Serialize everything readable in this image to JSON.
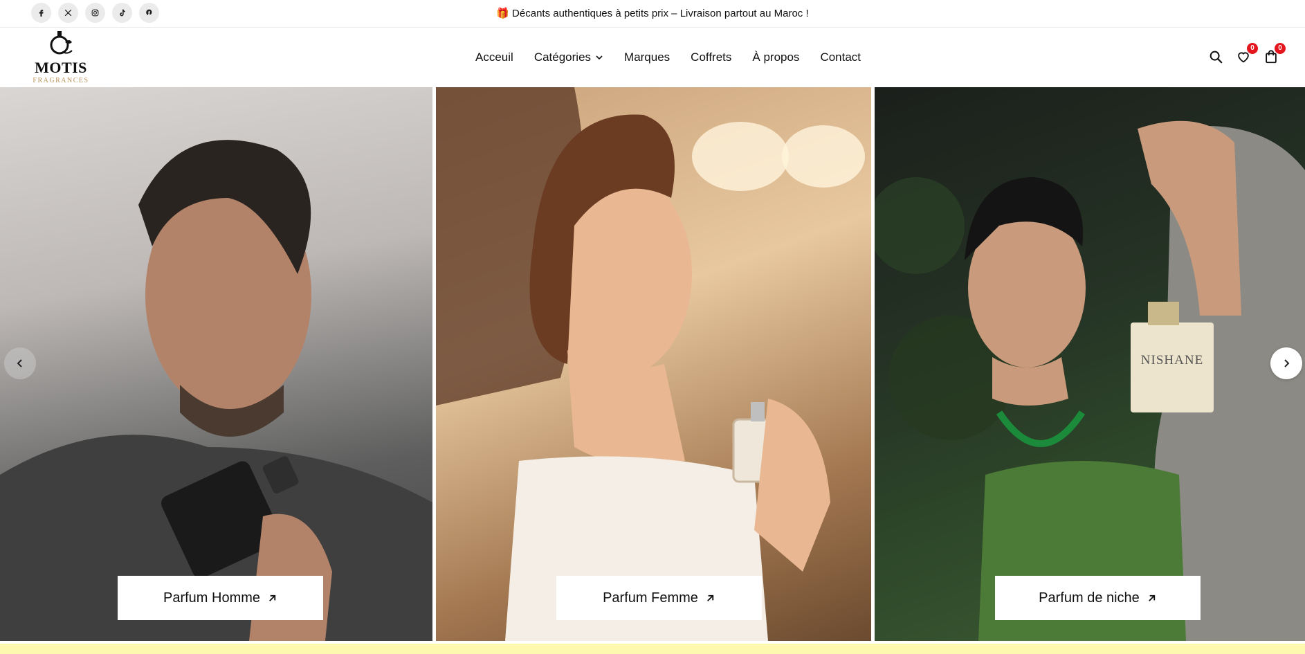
{
  "topbar": {
    "socials": [
      {
        "icon": "facebook-icon"
      },
      {
        "icon": "x-twitter-icon"
      },
      {
        "icon": "instagram-icon"
      },
      {
        "icon": "tiktok-icon"
      },
      {
        "icon": "pinterest-icon"
      }
    ],
    "announcement_icon": "🎁",
    "announcement": "Décants authentiques à petits prix – Livraison partout au Maroc !"
  },
  "header": {
    "logo_word": "MOTIS",
    "logo_sub": "FRAGRANCES",
    "nav": [
      "Acceuil",
      "Catégories",
      "Marques",
      "Coffrets",
      "À propos",
      "Contact"
    ],
    "wishlist_count": "0",
    "cart_count": "0"
  },
  "hero": {
    "panels": [
      {
        "label": "Parfum Homme",
        "image": "man-holding-perfume-photo"
      },
      {
        "label": "Parfum Femme",
        "image": "woman-spraying-perfume-photo"
      },
      {
        "label": "Parfum de niche",
        "image": "woman-with-niche-perfume-photo"
      }
    ]
  },
  "colors": {
    "badge": "#e3161d",
    "logo_accent": "#b8935a",
    "bottom_strip": "#fdfab0"
  }
}
